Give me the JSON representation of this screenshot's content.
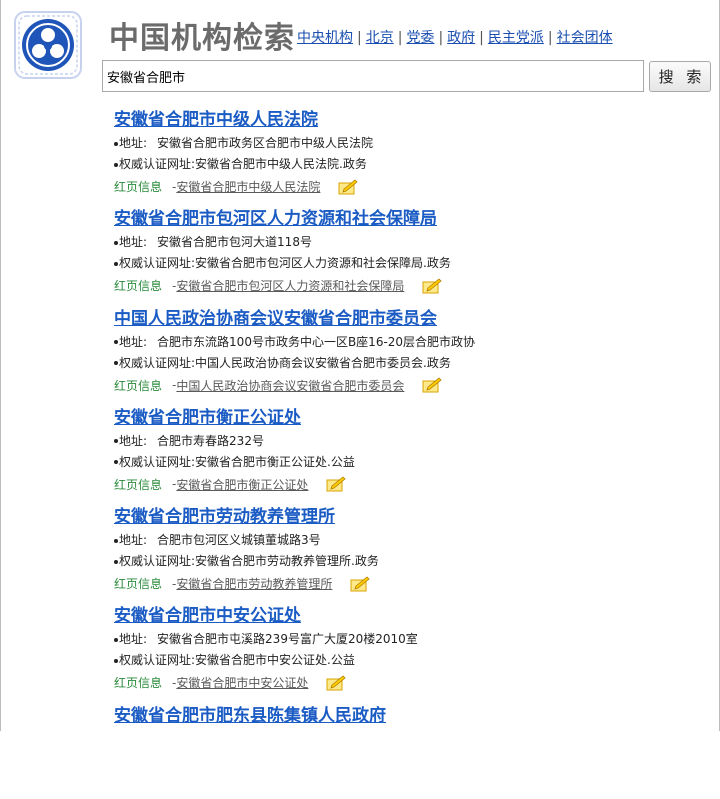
{
  "header": {
    "site_title": "中国机构检索",
    "nav": [
      "中央机构",
      "北京",
      "党委",
      "政府",
      "民主党派",
      "社会团体"
    ]
  },
  "search": {
    "value": "安徽省合肥市",
    "button_label": "搜 索"
  },
  "labels": {
    "address": "地址:",
    "auth_url": "权威认证网址:",
    "homepage": "红页信息",
    "dash": "-"
  },
  "results": [
    {
      "title": "安徽省合肥市中级人民法院",
      "address": "安徽省合肥市政务区合肥市中级人民法院",
      "auth": "安徽省合肥市中级人民法院.政务",
      "homepage": "安徽省合肥市中级人民法院"
    },
    {
      "title": "安徽省合肥市包河区人力资源和社会保障局",
      "address": "安徽省合肥市包河大道118号",
      "auth": "安徽省合肥市包河区人力资源和社会保障局.政务",
      "homepage": "安徽省合肥市包河区人力资源和社会保障局"
    },
    {
      "title": "中国人民政治协商会议安徽省合肥市委员会",
      "address": "合肥市东流路100号市政务中心一区B座16-20层合肥市政协",
      "auth": "中国人民政治协商会议安徽省合肥市委员会.政务",
      "homepage": "中国人民政治协商会议安徽省合肥市委员会"
    },
    {
      "title": "安徽省合肥市衡正公证处",
      "address": "合肥市寿春路232号",
      "auth": "安徽省合肥市衡正公证处.公益",
      "homepage": "安徽省合肥市衡正公证处"
    },
    {
      "title": "安徽省合肥市劳动教养管理所",
      "address": "合肥市包河区义城镇董城路3号",
      "auth": "安徽省合肥市劳动教养管理所.政务",
      "homepage": "安徽省合肥市劳动教养管理所"
    },
    {
      "title": "安徽省合肥市中安公证处",
      "address": "安徽省合肥市屯溪路239号富广大厦20楼2010室",
      "auth": "安徽省合肥市中安公证处.公益",
      "homepage": "安徽省合肥市中安公证处"
    },
    {
      "title": "安徽省合肥市肥东县陈集镇人民政府"
    }
  ]
}
